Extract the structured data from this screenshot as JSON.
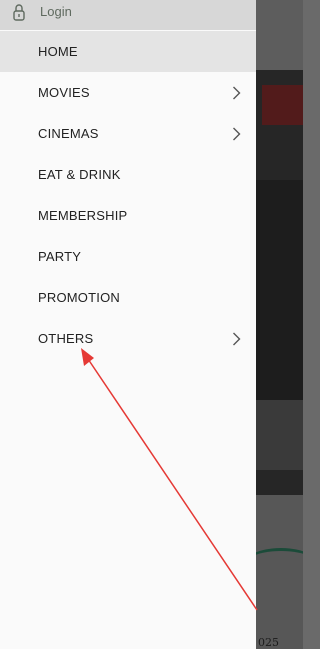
{
  "drawer": {
    "login_label": "Login",
    "items": [
      {
        "label": "HOME",
        "has_submenu": false,
        "active": true
      },
      {
        "label": "MOVIES",
        "has_submenu": true,
        "active": false
      },
      {
        "label": "CINEMAS",
        "has_submenu": true,
        "active": false
      },
      {
        "label": "EAT & DRINK",
        "has_submenu": false,
        "active": false
      },
      {
        "label": "MEMBERSHIP",
        "has_submenu": false,
        "active": false
      },
      {
        "label": "PARTY",
        "has_submenu": false,
        "active": false
      },
      {
        "label": "PROMOTION",
        "has_submenu": false,
        "active": false
      },
      {
        "label": "OTHERS",
        "has_submenu": true,
        "active": false
      }
    ]
  },
  "background": {
    "year_fragment": "025"
  },
  "annotation": {
    "arrow_color": "#e53935",
    "target": "OTHERS"
  },
  "icons": {
    "lock": "lock-icon",
    "chevron": "chevron-right-icon"
  }
}
